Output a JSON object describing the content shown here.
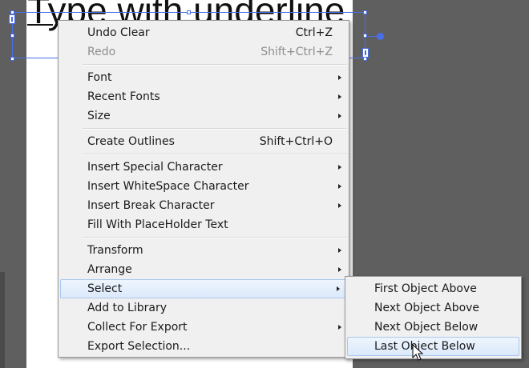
{
  "canvas": {
    "text": "Type with underline"
  },
  "context_menu": {
    "groups": [
      [
        {
          "label": "Undo Clear",
          "shortcut": "Ctrl+Z"
        },
        {
          "label": "Redo",
          "shortcut": "Shift+Ctrl+Z",
          "disabled": true
        }
      ],
      [
        {
          "label": "Font",
          "submenu": true
        },
        {
          "label": "Recent Fonts",
          "submenu": true
        },
        {
          "label": "Size",
          "submenu": true
        }
      ],
      [
        {
          "label": "Create Outlines",
          "shortcut": "Shift+Ctrl+O"
        }
      ],
      [
        {
          "label": "Insert Special Character",
          "submenu": true
        },
        {
          "label": "Insert WhiteSpace Character",
          "submenu": true
        },
        {
          "label": "Insert Break Character",
          "submenu": true
        },
        {
          "label": "Fill With PlaceHolder Text"
        }
      ],
      [
        {
          "label": "Transform",
          "submenu": true
        },
        {
          "label": "Arrange",
          "submenu": true
        },
        {
          "label": "Select",
          "submenu": true,
          "highlighted": true
        },
        {
          "label": "Add to Library"
        },
        {
          "label": "Collect For Export",
          "submenu": true
        },
        {
          "label": "Export Selection..."
        }
      ]
    ]
  },
  "select_submenu": {
    "items": [
      {
        "label": "First Object Above"
      },
      {
        "label": "Next Object Above"
      },
      {
        "label": "Next Object Below"
      },
      {
        "label": "Last Object Below",
        "highlighted": true
      }
    ]
  },
  "colors": {
    "selection": "#4a6ee8",
    "menu_bg": "#f0f0f0",
    "page_bg": "#5f5f5f"
  },
  "icons": {
    "submenu_arrow": "chevron-right-icon",
    "cursor": "mouse-pointer-icon"
  }
}
